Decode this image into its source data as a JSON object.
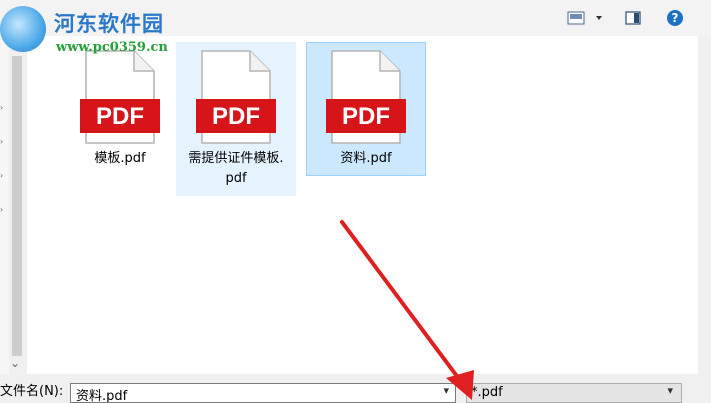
{
  "watermark": {
    "title": "河东软件园",
    "url": "www.pc0359.cn"
  },
  "toolbar": {
    "view_icon": "view-options-icon",
    "pane_icon": "preview-pane-icon",
    "help_glyph": "?"
  },
  "files": [
    {
      "name": "模板.pdf",
      "icon_text": "PDF",
      "state": "normal"
    },
    {
      "name": "需提供证件模板.pdf",
      "icon_text": "PDF",
      "state": "hover"
    },
    {
      "name": "资料.pdf",
      "icon_text": "PDF",
      "state": "selected"
    }
  ],
  "footer": {
    "filename_label": "文件名(N):",
    "filename_value": "资料.pdf",
    "filetype_value": "*.pdf"
  },
  "colors": {
    "pdf_red": "#d7141a",
    "selection": "#cce8ff",
    "arrow": "#e02020"
  }
}
